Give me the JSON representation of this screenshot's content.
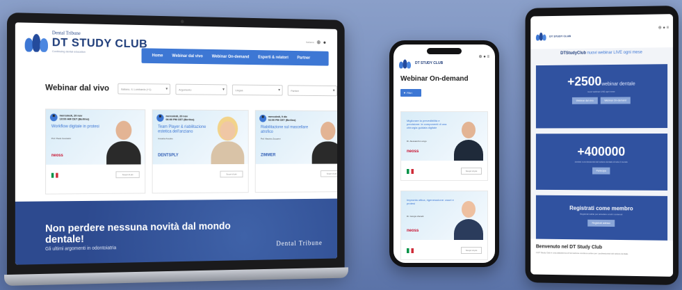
{
  "laptop": {
    "logo": {
      "small": "Dental Tribune",
      "big": "DT STUDY CLUB",
      "tagline": "Continuing dental education"
    },
    "nav": [
      "Home",
      "Webinar dal vivo",
      "Webinar On-demand",
      "Esperti & relatori",
      "Partner"
    ],
    "language": "Italiano",
    "section_title": "Webinar dal vivo",
    "filters": [
      "Italiano, Il, Lombardo (+1)",
      "Argomento",
      "Lingua",
      "Partner"
    ],
    "cards": [
      {
        "date": "mercoledì, 20 nov",
        "time": "10:00 AM CET (Berlino)",
        "title": "Workflow digitale in protesi",
        "author": "Prof. Paolo Cenciarini",
        "sponsor": "neoss",
        "more": "Scopri di più"
      },
      {
        "date": "mercoledì, 20 nov",
        "time": "06:00 PM CET (Berlino)",
        "title": "Team Player & riabilitazione estetica dell'anziano",
        "author": "Annarita Amodeo",
        "sponsor": "DENTSPLY",
        "more": "Scopri di più"
      },
      {
        "date": "mercoledì, 9 dic",
        "time": "02:00 PM CET (Berlino)",
        "title": "Riabilitazione sul mascellare atrofico",
        "author": "Prof. Maurizio Zuccarini",
        "sponsor": "ZIMMER",
        "more": "Scopri di più"
      }
    ],
    "banner": {
      "title": "Non perdere nessuna novità dal mondo dentale!",
      "subtitle": "Gli ultimi argomenti in odontoiatria",
      "logo": "Dental Tribune"
    }
  },
  "phone": {
    "logo": "DT STUDY CLUB",
    "title": "Webinar On-demand",
    "filter": "Filtri",
    "cards": [
      {
        "title": "Migliorare la prevedibilità e precisione: le componenti di una chirurgia guidata digitale",
        "author": "Dr. Alessandro Longo",
        "sponsor": "neoss",
        "more": "Scopri di più"
      },
      {
        "title": "Impronta ottica, rigenerazione: ossei e protesi",
        "author": "Dr. Giorgio Zanatti",
        "sponsor": "neoss",
        "more": "Scopri di più"
      }
    ]
  },
  "tablet": {
    "logo": "DT STUDY CLUB",
    "tagline_brand": "DTStudyClub",
    "tagline_rest": "nuovi webinar LIVE ogni mese",
    "box1": {
      "big": "+2500",
      "big_suffix": "webinar dentale",
      "note": "nuovi webinar LIVE ogni mese",
      "btn1": "Webinar dal vivo",
      "btn2": "Webinar On-demand"
    },
    "box2": {
      "big": "+400000",
      "note": "dentisti e professionisti del settore dentale di tutto il mondo",
      "btn": "Partecipa"
    },
    "box3": {
      "title": "Registrati come membro",
      "note": "Registrati subito per accedere a tutti i contenuti",
      "btn": "Registrati adesso"
    },
    "footer_title": "Benvenuto nel DT Study Club",
    "footer_text": "Il DT Study Club è una piattaforma di formazione continua online per i professionisti del settore dentale."
  },
  "colors": {
    "brand_blue": "#3d77d4",
    "dark_blue": "#2d4a8f",
    "background": "#7a8fbf"
  }
}
